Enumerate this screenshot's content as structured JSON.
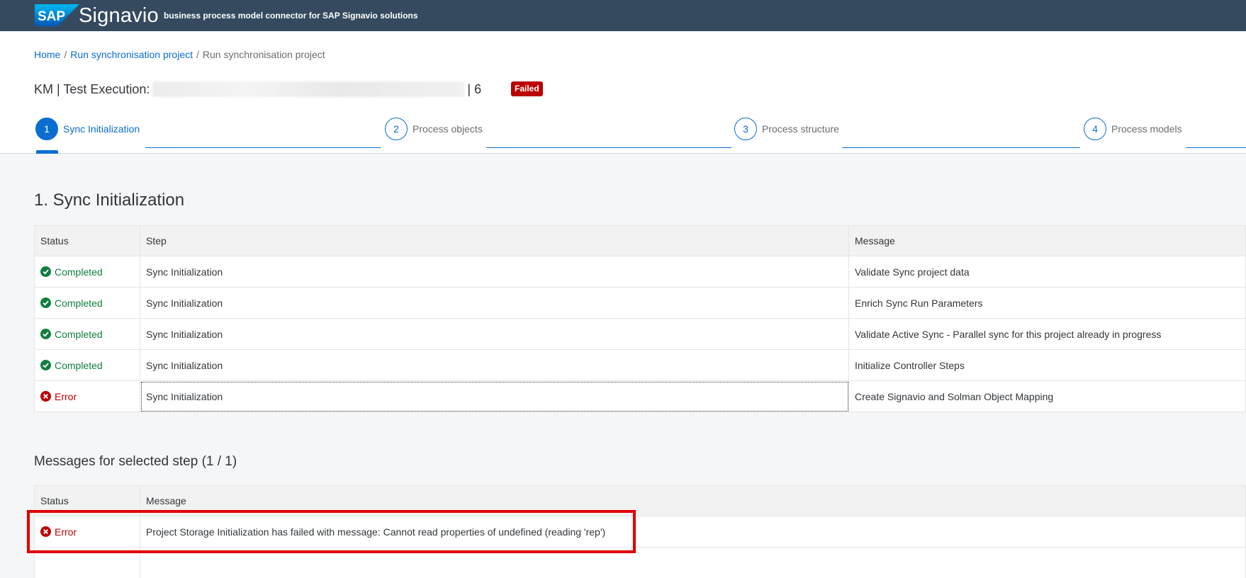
{
  "shell": {
    "logo_text": "SAP",
    "brand": "Signavio",
    "subtitle": "business process model connector for SAP Signavio solutions",
    "colors": {
      "shell_bg": "#354a5f",
      "logo_blue": "#0a6ed1"
    }
  },
  "breadcrumb": {
    "items": [
      "Home",
      "Run synchronisation project"
    ],
    "current": "Run synchronisation project",
    "separator": "/"
  },
  "page": {
    "title_prefix": "KM | Test Execution:",
    "title_suffix": "| 6",
    "status_badge": "Failed"
  },
  "wizard": {
    "steps": [
      {
        "number": "1",
        "label": "Sync Initialization",
        "active": true
      },
      {
        "number": "2",
        "label": "Process objects",
        "active": false
      },
      {
        "number": "3",
        "label": "Process structure",
        "active": false
      },
      {
        "number": "4",
        "label": "Process models",
        "active": false
      }
    ]
  },
  "section": {
    "title": "1. Sync Initialization",
    "columns": [
      "Status",
      "Step",
      "Message"
    ],
    "rows": [
      {
        "status": "Completed",
        "step": "Sync Initialization",
        "message": "Validate Sync project data"
      },
      {
        "status": "Completed",
        "step": "Sync Initialization",
        "message": "Enrich Sync Run Parameters"
      },
      {
        "status": "Completed",
        "step": "Sync Initialization",
        "message": "Validate Active Sync - Parallel sync for this project already in progress"
      },
      {
        "status": "Completed",
        "step": "Sync Initialization",
        "message": "Initialize Controller Steps"
      },
      {
        "status": "Error",
        "step": "Sync Initialization",
        "message": "Create Signavio and Solman Object Mapping"
      }
    ]
  },
  "messages": {
    "title": "Messages for selected step (1 / 1)",
    "columns": [
      "Status",
      "Message"
    ],
    "rows": [
      {
        "status": "Error",
        "message": "Project Storage Initialization has failed with message: Cannot read properties of undefined (reading 'rep')"
      }
    ]
  },
  "status_colors": {
    "completed": "#107e3e",
    "error": "#bb0000",
    "highlight": "#e20000"
  }
}
